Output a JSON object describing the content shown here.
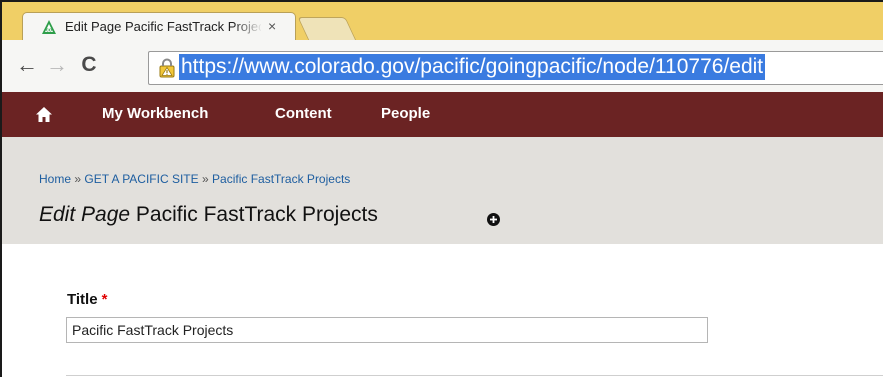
{
  "browser": {
    "tab": {
      "title": "Edit Page Pacific FastTrack Projects",
      "close": "×",
      "favicon": "colorado-triangle-icon"
    },
    "toolbar": {
      "back": "←",
      "forward": "→",
      "reload": "C"
    },
    "address_bar": {
      "url": "https://www.colorado.gov/pacific/goingpacific/node/110776/edit",
      "lock_icon": "warning-lock-icon"
    }
  },
  "admin_toolbar": {
    "home_icon": "home-icon",
    "items": [
      {
        "label": "My Workbench"
      },
      {
        "label": "Content"
      },
      {
        "label": "People"
      }
    ]
  },
  "page": {
    "breadcrumb": [
      {
        "label": "Home"
      },
      {
        "label": "GET A PACIFIC SITE"
      },
      {
        "label": "Pacific FastTrack Projects"
      }
    ],
    "breadcrumb_separator": "»",
    "title_prefix": "Edit Page",
    "title": "Pacific FastTrack Projects",
    "shortcut_icon": "add-shortcut-icon"
  },
  "form": {
    "title_field": {
      "label": "Title",
      "required_marker": "*",
      "value": "Pacific FastTrack Projects"
    }
  },
  "colors": {
    "admin_bar": "#6b2323",
    "url_highlight": "#3a7be0",
    "link": "#1e5ea0",
    "required": "#e00000",
    "tabstrip": "#f0cf66"
  }
}
